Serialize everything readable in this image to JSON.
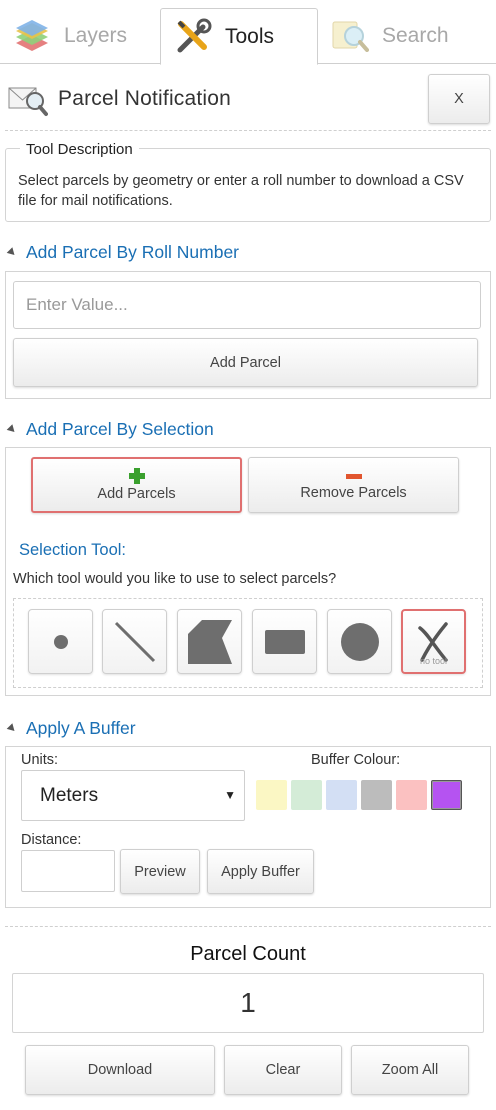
{
  "tabs": [
    {
      "label": "Layers",
      "icon": "layers-icon"
    },
    {
      "label": "Tools",
      "icon": "tools-icon"
    },
    {
      "label": "Search",
      "icon": "search-icon"
    }
  ],
  "header": {
    "title": "Parcel Notification",
    "close_label": "X"
  },
  "description": {
    "legend": "Tool Description",
    "text": "Select parcels by geometry or enter a roll number to download a CSV file for mail notifications."
  },
  "roll": {
    "heading": "Add Parcel By Roll Number",
    "placeholder": "Enter Value...",
    "add_label": "Add Parcel"
  },
  "selection": {
    "heading": "Add Parcel By Selection",
    "add_label": "Add Parcels",
    "remove_label": "Remove Parcels",
    "tool_label": "Selection Tool:",
    "tool_hint": "Which tool would you like to use to select parcels?",
    "tools": [
      "point",
      "line",
      "polygon",
      "rectangle",
      "circle",
      "no tool"
    ],
    "active_tool": "no tool",
    "no_tool_label": "no tool"
  },
  "buffer": {
    "heading": "Apply A Buffer",
    "units_label": "Units:",
    "units_value": "Meters",
    "colour_label": "Buffer Colour:",
    "colours": [
      "#fbf7c4",
      "#d4ecd7",
      "#d3dff4",
      "#bcbcbc",
      "#fbc1c1",
      "#b553f1"
    ],
    "selected_colour": "#b553f1",
    "distance_label": "Distance:",
    "distance_value": "",
    "preview_label": "Preview",
    "apply_label": "Apply Buffer"
  },
  "count": {
    "title": "Parcel Count",
    "value": "1"
  },
  "actions": {
    "download_label": "Download",
    "clear_label": "Clear",
    "zoom_label": "Zoom All"
  }
}
